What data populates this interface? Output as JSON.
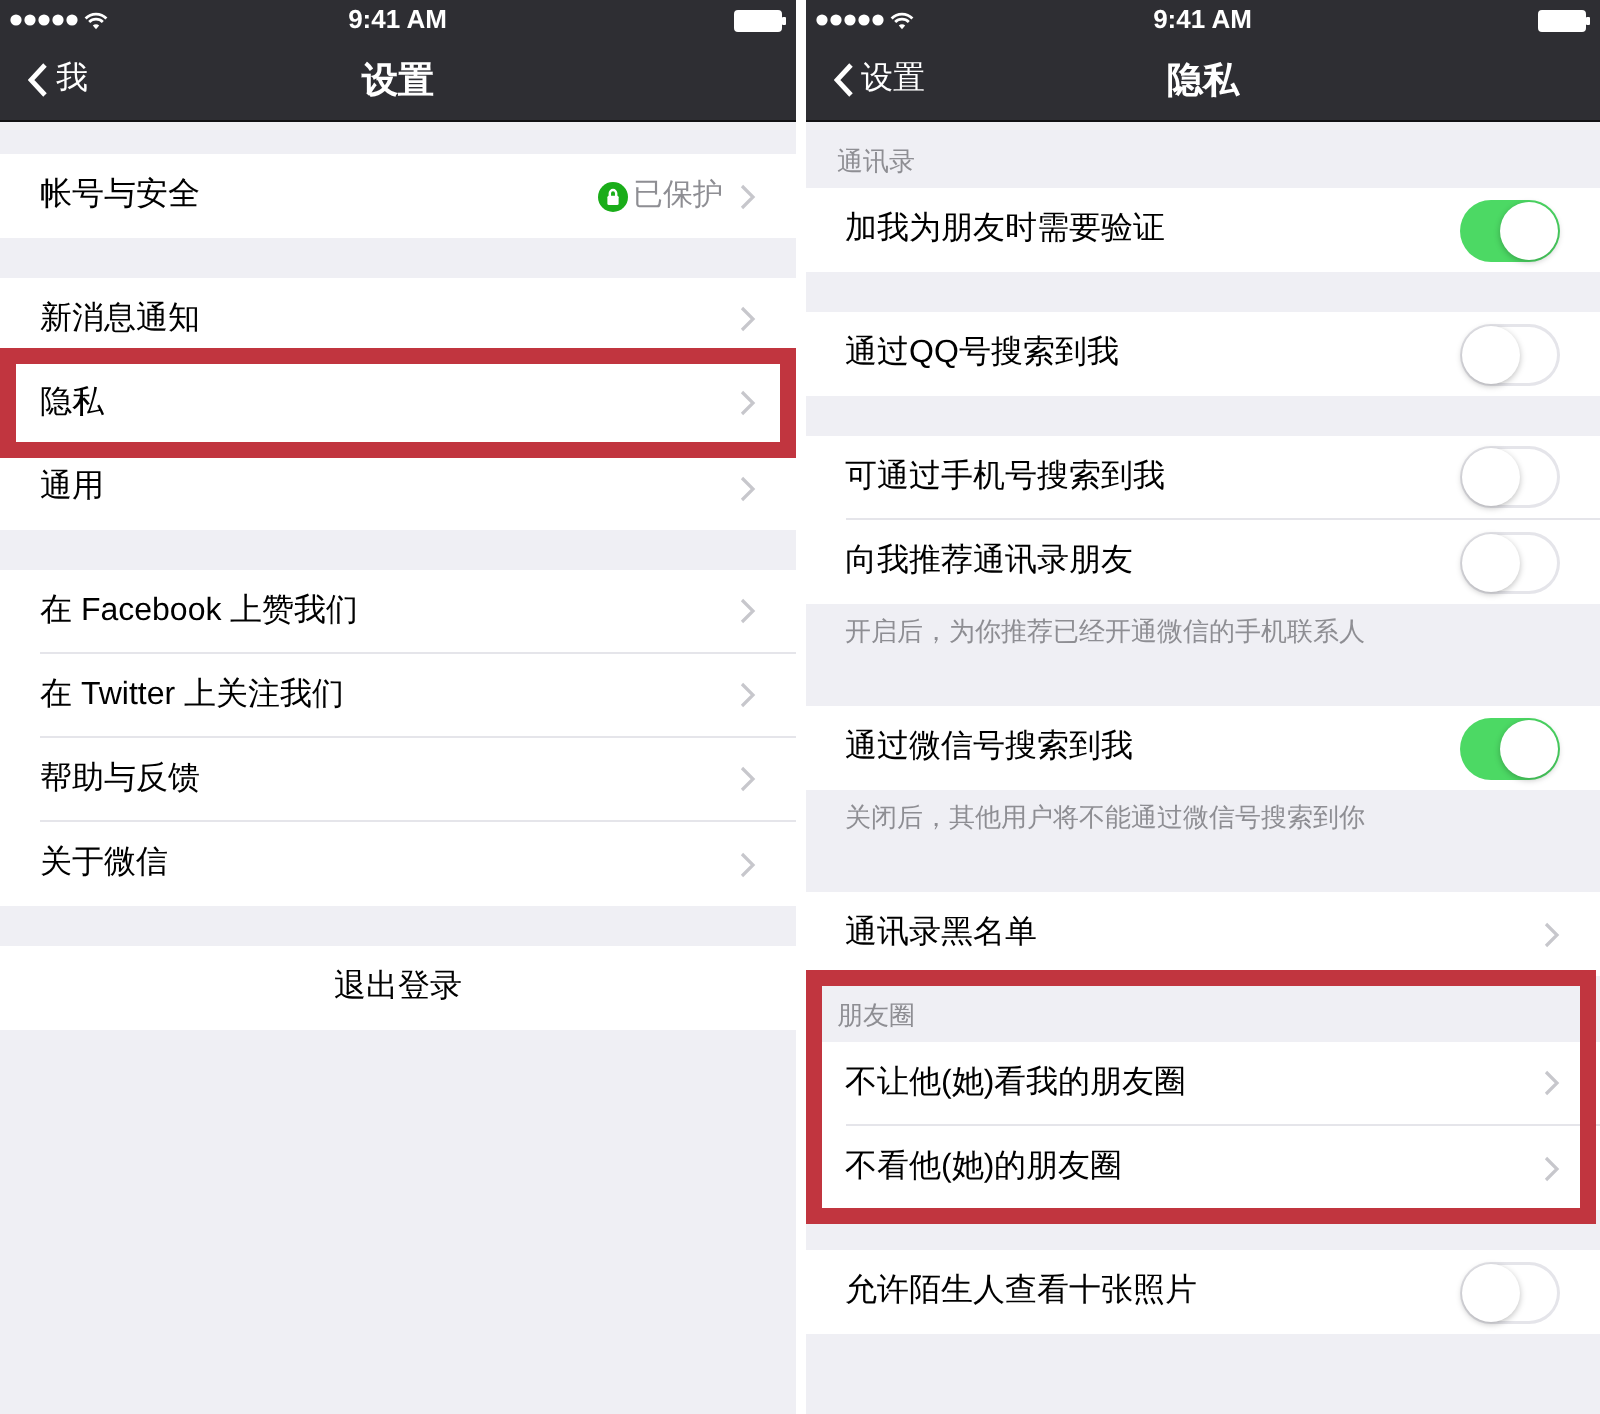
{
  "screens": [
    {
      "status_bar": {
        "time": "9:41 AM"
      },
      "nav": {
        "back": "我",
        "title": "设置"
      },
      "sections": [
        {
          "highlighted": false,
          "rows": [
            {
              "kind": "link",
              "label": "帐号与安全",
              "detail": "已保护",
              "highlighted": false
            }
          ]
        },
        {
          "highlighted": false,
          "rows": [
            {
              "kind": "link",
              "label": "新消息通知",
              "highlighted": false
            },
            {
              "kind": "link",
              "label": "隐私",
              "highlighted": true
            },
            {
              "kind": "link",
              "label": "通用",
              "highlighted": false
            }
          ]
        },
        {
          "highlighted": false,
          "rows": [
            {
              "kind": "link",
              "label": "在 Facebook 上赞我们",
              "highlighted": false
            },
            {
              "kind": "link",
              "label": "在 Twitter 上关注我们",
              "highlighted": false
            },
            {
              "kind": "link",
              "label": "帮助与反馈",
              "highlighted": false
            },
            {
              "kind": "link",
              "label": "关于微信",
              "highlighted": false
            }
          ]
        },
        {
          "highlighted": false,
          "rows": [
            {
              "kind": "action",
              "label": "退出登录",
              "highlighted": false
            }
          ]
        }
      ]
    },
    {
      "status_bar": {
        "time": "9:41 AM"
      },
      "nav": {
        "back": "设置",
        "title": "隐私"
      },
      "sections": [
        {
          "header": "通讯录",
          "highlighted": false,
          "rows": [
            {
              "kind": "toggle",
              "label": "加我为朋友时需要验证",
              "on": true,
              "highlighted": false
            }
          ]
        },
        {
          "highlighted": false,
          "rows": [
            {
              "kind": "toggle",
              "label": "通过QQ号搜索到我",
              "on": false,
              "highlighted": false
            }
          ]
        },
        {
          "highlighted": false,
          "rows": [
            {
              "kind": "toggle",
              "label": "可通过手机号搜索到我",
              "on": false,
              "highlighted": false
            },
            {
              "kind": "toggle",
              "label": "向我推荐通讯录朋友",
              "on": false,
              "highlighted": false
            }
          ],
          "footer": "开启后，为你推荐已经开通微信的手机联系人"
        },
        {
          "highlighted": false,
          "rows": [
            {
              "kind": "toggle",
              "label": "通过微信号搜索到我",
              "on": true,
              "highlighted": false
            }
          ],
          "footer": "关闭后，其他用户将不能通过微信号搜索到你"
        },
        {
          "highlighted": false,
          "rows": [
            {
              "kind": "link",
              "label": "通讯录黑名单",
              "highlighted": false
            }
          ]
        },
        {
          "header": "朋友圈",
          "highlighted": true,
          "rows": [
            {
              "kind": "link",
              "label": "不让他(她)看我的朋友圈",
              "highlighted": false
            },
            {
              "kind": "link",
              "label": "不看他(她)的朋友圈",
              "highlighted": false
            }
          ]
        },
        {
          "highlighted": false,
          "rows": [
            {
              "kind": "toggle",
              "label": "允许陌生人查看十张照片",
              "on": false,
              "highlighted": false
            }
          ]
        }
      ]
    }
  ]
}
